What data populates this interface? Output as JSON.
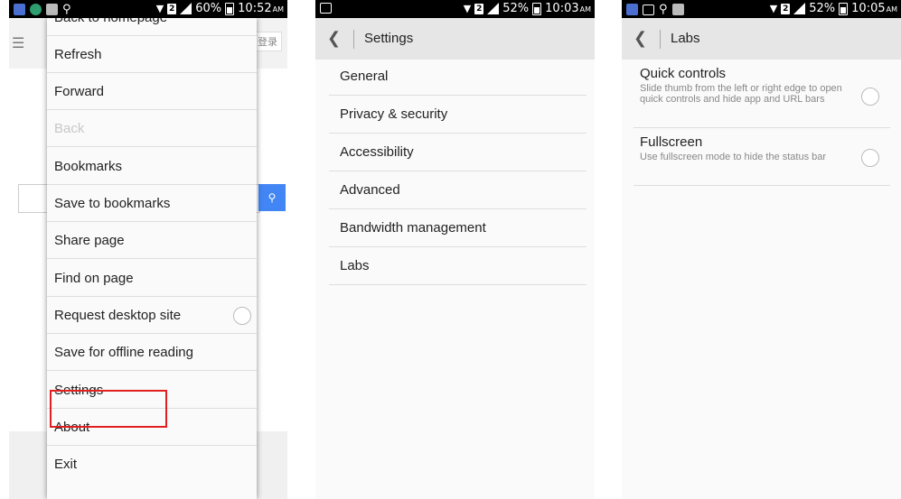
{
  "screens": [
    {
      "status": {
        "time": "10:52",
        "ampm": "AM",
        "battery": "60%"
      },
      "background": {
        "login_label": "登录"
      },
      "menu": {
        "items": [
          {
            "label": "Back to homepage"
          },
          {
            "label": "Refresh"
          },
          {
            "label": "Forward"
          },
          {
            "label": "Back",
            "disabled": true
          },
          {
            "label": "Bookmarks"
          },
          {
            "label": "Save to bookmarks"
          },
          {
            "label": "Share page"
          },
          {
            "label": "Find on page"
          },
          {
            "label": "Request desktop site",
            "toggle": "off"
          },
          {
            "label": "Save for offline reading"
          },
          {
            "label": "Settings",
            "highlighted": true
          },
          {
            "label": "About"
          },
          {
            "label": "Exit"
          }
        ]
      }
    },
    {
      "status": {
        "time": "10:03",
        "ampm": "AM",
        "battery": "52%"
      },
      "title": "Settings",
      "items": [
        {
          "label": "General"
        },
        {
          "label": "Privacy & security"
        },
        {
          "label": "Accessibility"
        },
        {
          "label": "Advanced"
        },
        {
          "label": "Bandwidth management"
        },
        {
          "label": "Labs"
        }
      ]
    },
    {
      "status": {
        "time": "10:05",
        "ampm": "AM",
        "battery": "52%"
      },
      "title": "Labs",
      "items": [
        {
          "title": "Quick controls",
          "description": "Slide thumb from the left or right edge to open quick controls and hide app and URL bars",
          "toggle": "off"
        },
        {
          "title": "Fullscreen",
          "description": "Use fullscreen mode to hide the status bar",
          "toggle": "off"
        }
      ]
    }
  ],
  "colors": {
    "highlight_border": "#e02020",
    "search_button": "#4285f4",
    "status_bar": "#000000",
    "action_bar": "#e6e6e6"
  },
  "icons": [
    "back-chevron-icon",
    "wifi-icon",
    "signal-icon",
    "battery-icon",
    "menu-icon",
    "search-icon",
    "radio-off-icon"
  ]
}
